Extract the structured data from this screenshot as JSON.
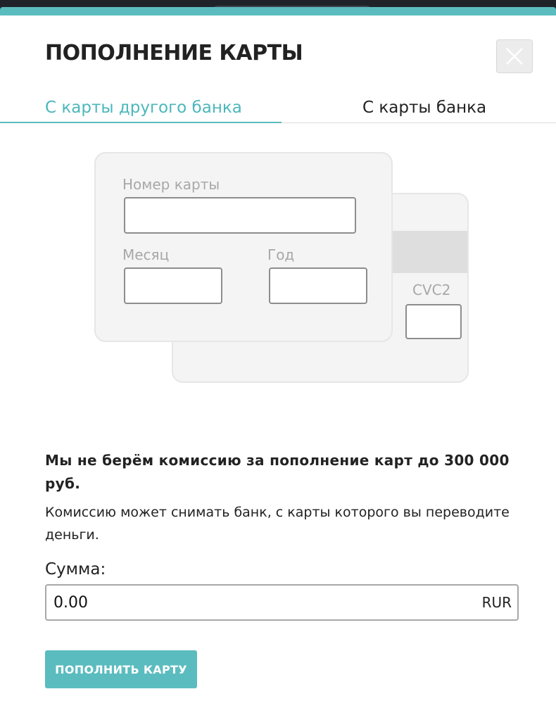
{
  "modal": {
    "title": "ПОПОЛНЕНИЕ КАРТЫ",
    "close_icon": "close-icon"
  },
  "tabs": [
    {
      "label": "С карты другого банка",
      "active": true
    },
    {
      "label": "С карты банка",
      "active": false
    }
  ],
  "card_form": {
    "card_number_label": "Номер карты",
    "card_number_value": "",
    "month_label": "Месяц",
    "month_value": "",
    "year_label": "Год",
    "year_value": "",
    "cvc_label": "CVC2",
    "cvc_value": ""
  },
  "notice": {
    "bold": "Мы не берём комиссию за пополнение карт до 300 000 руб.",
    "regular": "Комиссию может снимать банк, с карты которого вы переводите деньги."
  },
  "amount": {
    "label": "Сумма:",
    "value": "0.00",
    "currency": "RUR"
  },
  "submit_label": "ПОПОЛНИТЬ КАРТУ",
  "colors": {
    "accent": "#5bbcbf",
    "tab_active_text": "#4cb7bb"
  }
}
